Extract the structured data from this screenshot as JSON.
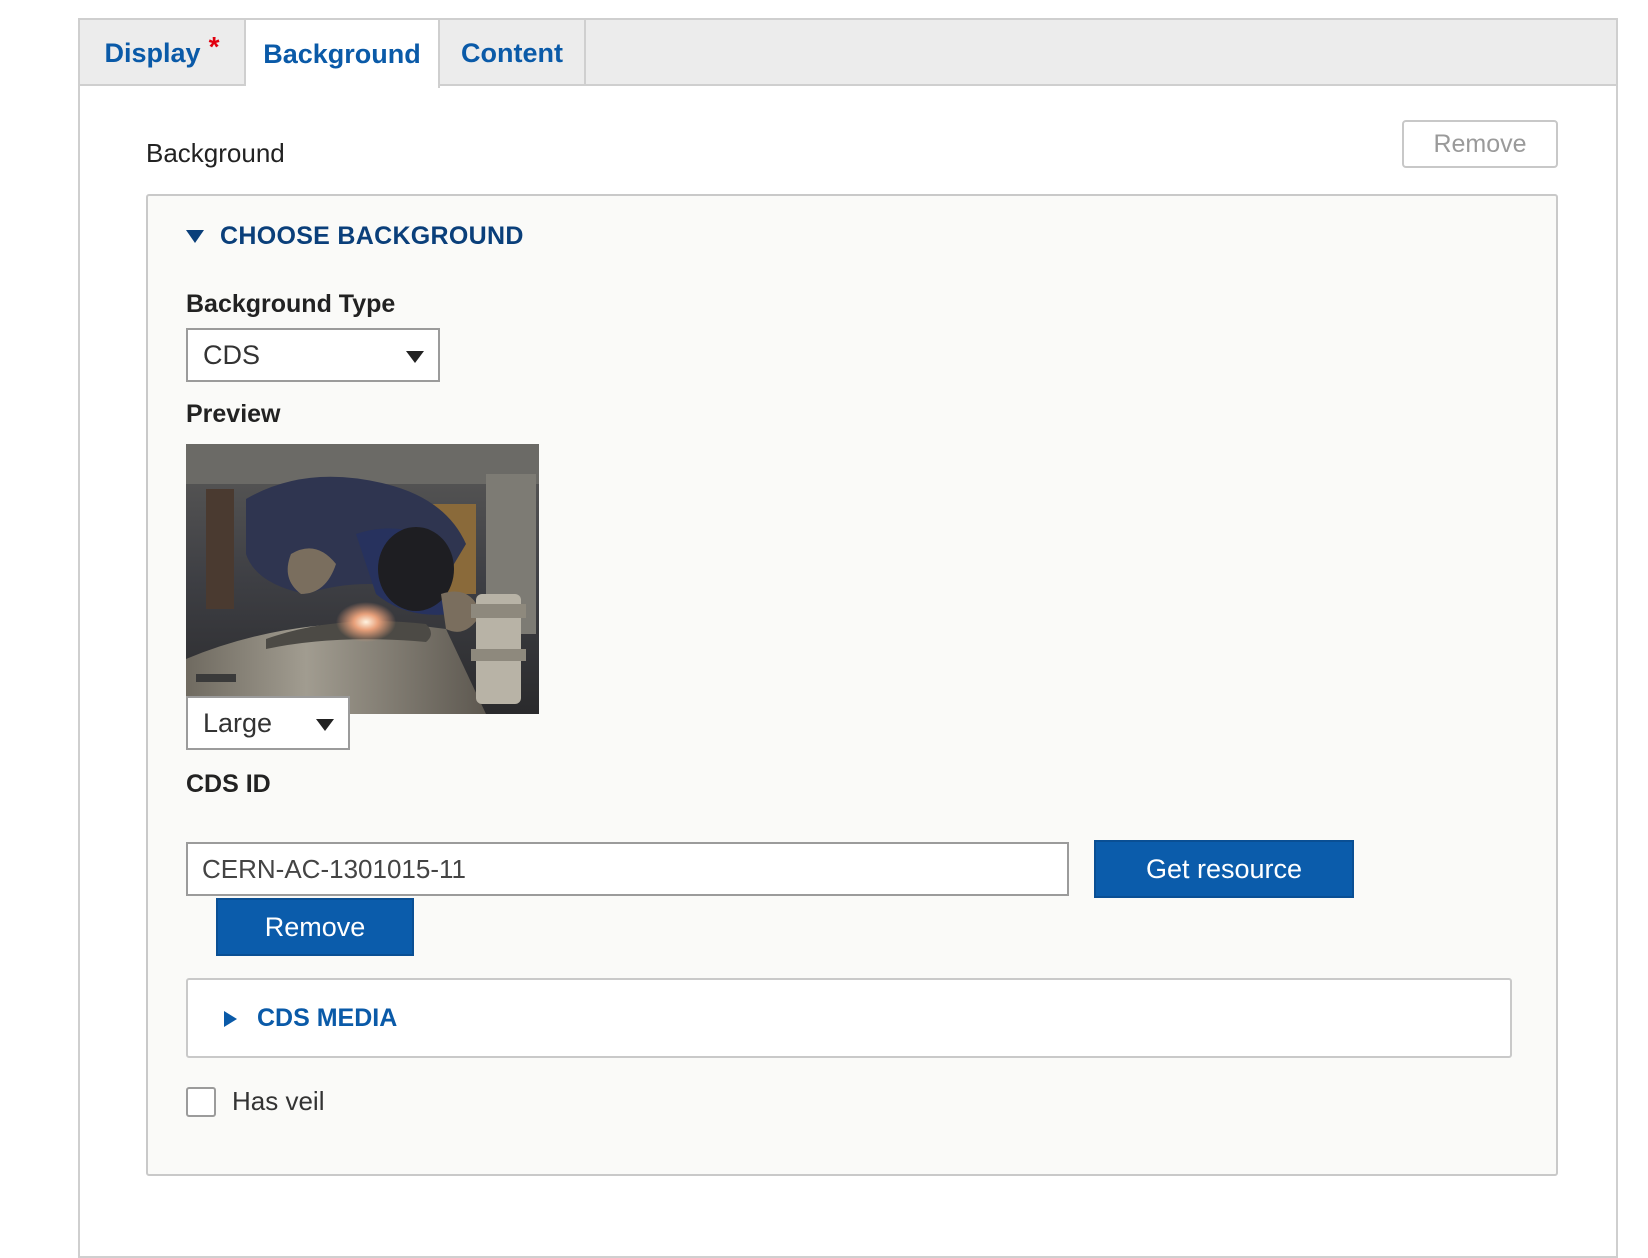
{
  "tabs": [
    {
      "label": "Display",
      "required_mark": "*"
    },
    {
      "label": "Background"
    },
    {
      "label": "Content"
    }
  ],
  "section": {
    "title": "Background",
    "remove_label": "Remove"
  },
  "choose_background": {
    "summary": "CHOOSE BACKGROUND",
    "background_type": {
      "label": "Background Type",
      "value": "CDS"
    },
    "preview": {
      "label": "Preview",
      "size_value": "Large"
    },
    "cds_id": {
      "label": "CDS ID",
      "value": "CERN-AC-1301015-11"
    },
    "get_resource_label": "Get resource",
    "remove_label": "Remove",
    "cds_media": {
      "summary": "CDS MEDIA"
    },
    "has_veil": {
      "label": "Has veil",
      "checked": false
    }
  },
  "colors": {
    "link": "#0a5aa8",
    "primary_button": "#0b5cab",
    "required": "#e1000f"
  }
}
